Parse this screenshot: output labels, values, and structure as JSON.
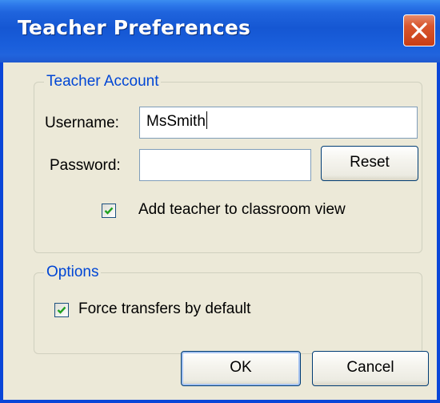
{
  "window": {
    "title": "Teacher Preferences"
  },
  "teacher_account": {
    "group_label": "Teacher Account",
    "username_label": "Username:",
    "username_value": "MsSmith",
    "password_label": "Password:",
    "password_value": "",
    "reset_label": "Reset",
    "add_teacher_label": "Add teacher to classroom view",
    "add_teacher_checked": true
  },
  "options": {
    "group_label": "Options",
    "force_transfers_label": "Force transfers by default",
    "force_transfers_checked": true
  },
  "buttons": {
    "ok_label": "OK",
    "cancel_label": "Cancel"
  },
  "colors": {
    "titlebar": "#1557d3",
    "group_label": "#0046d5",
    "check": "#21a121",
    "close": "#c83e15"
  },
  "icons": {
    "close": "close-icon",
    "check": "checkmark-icon"
  }
}
